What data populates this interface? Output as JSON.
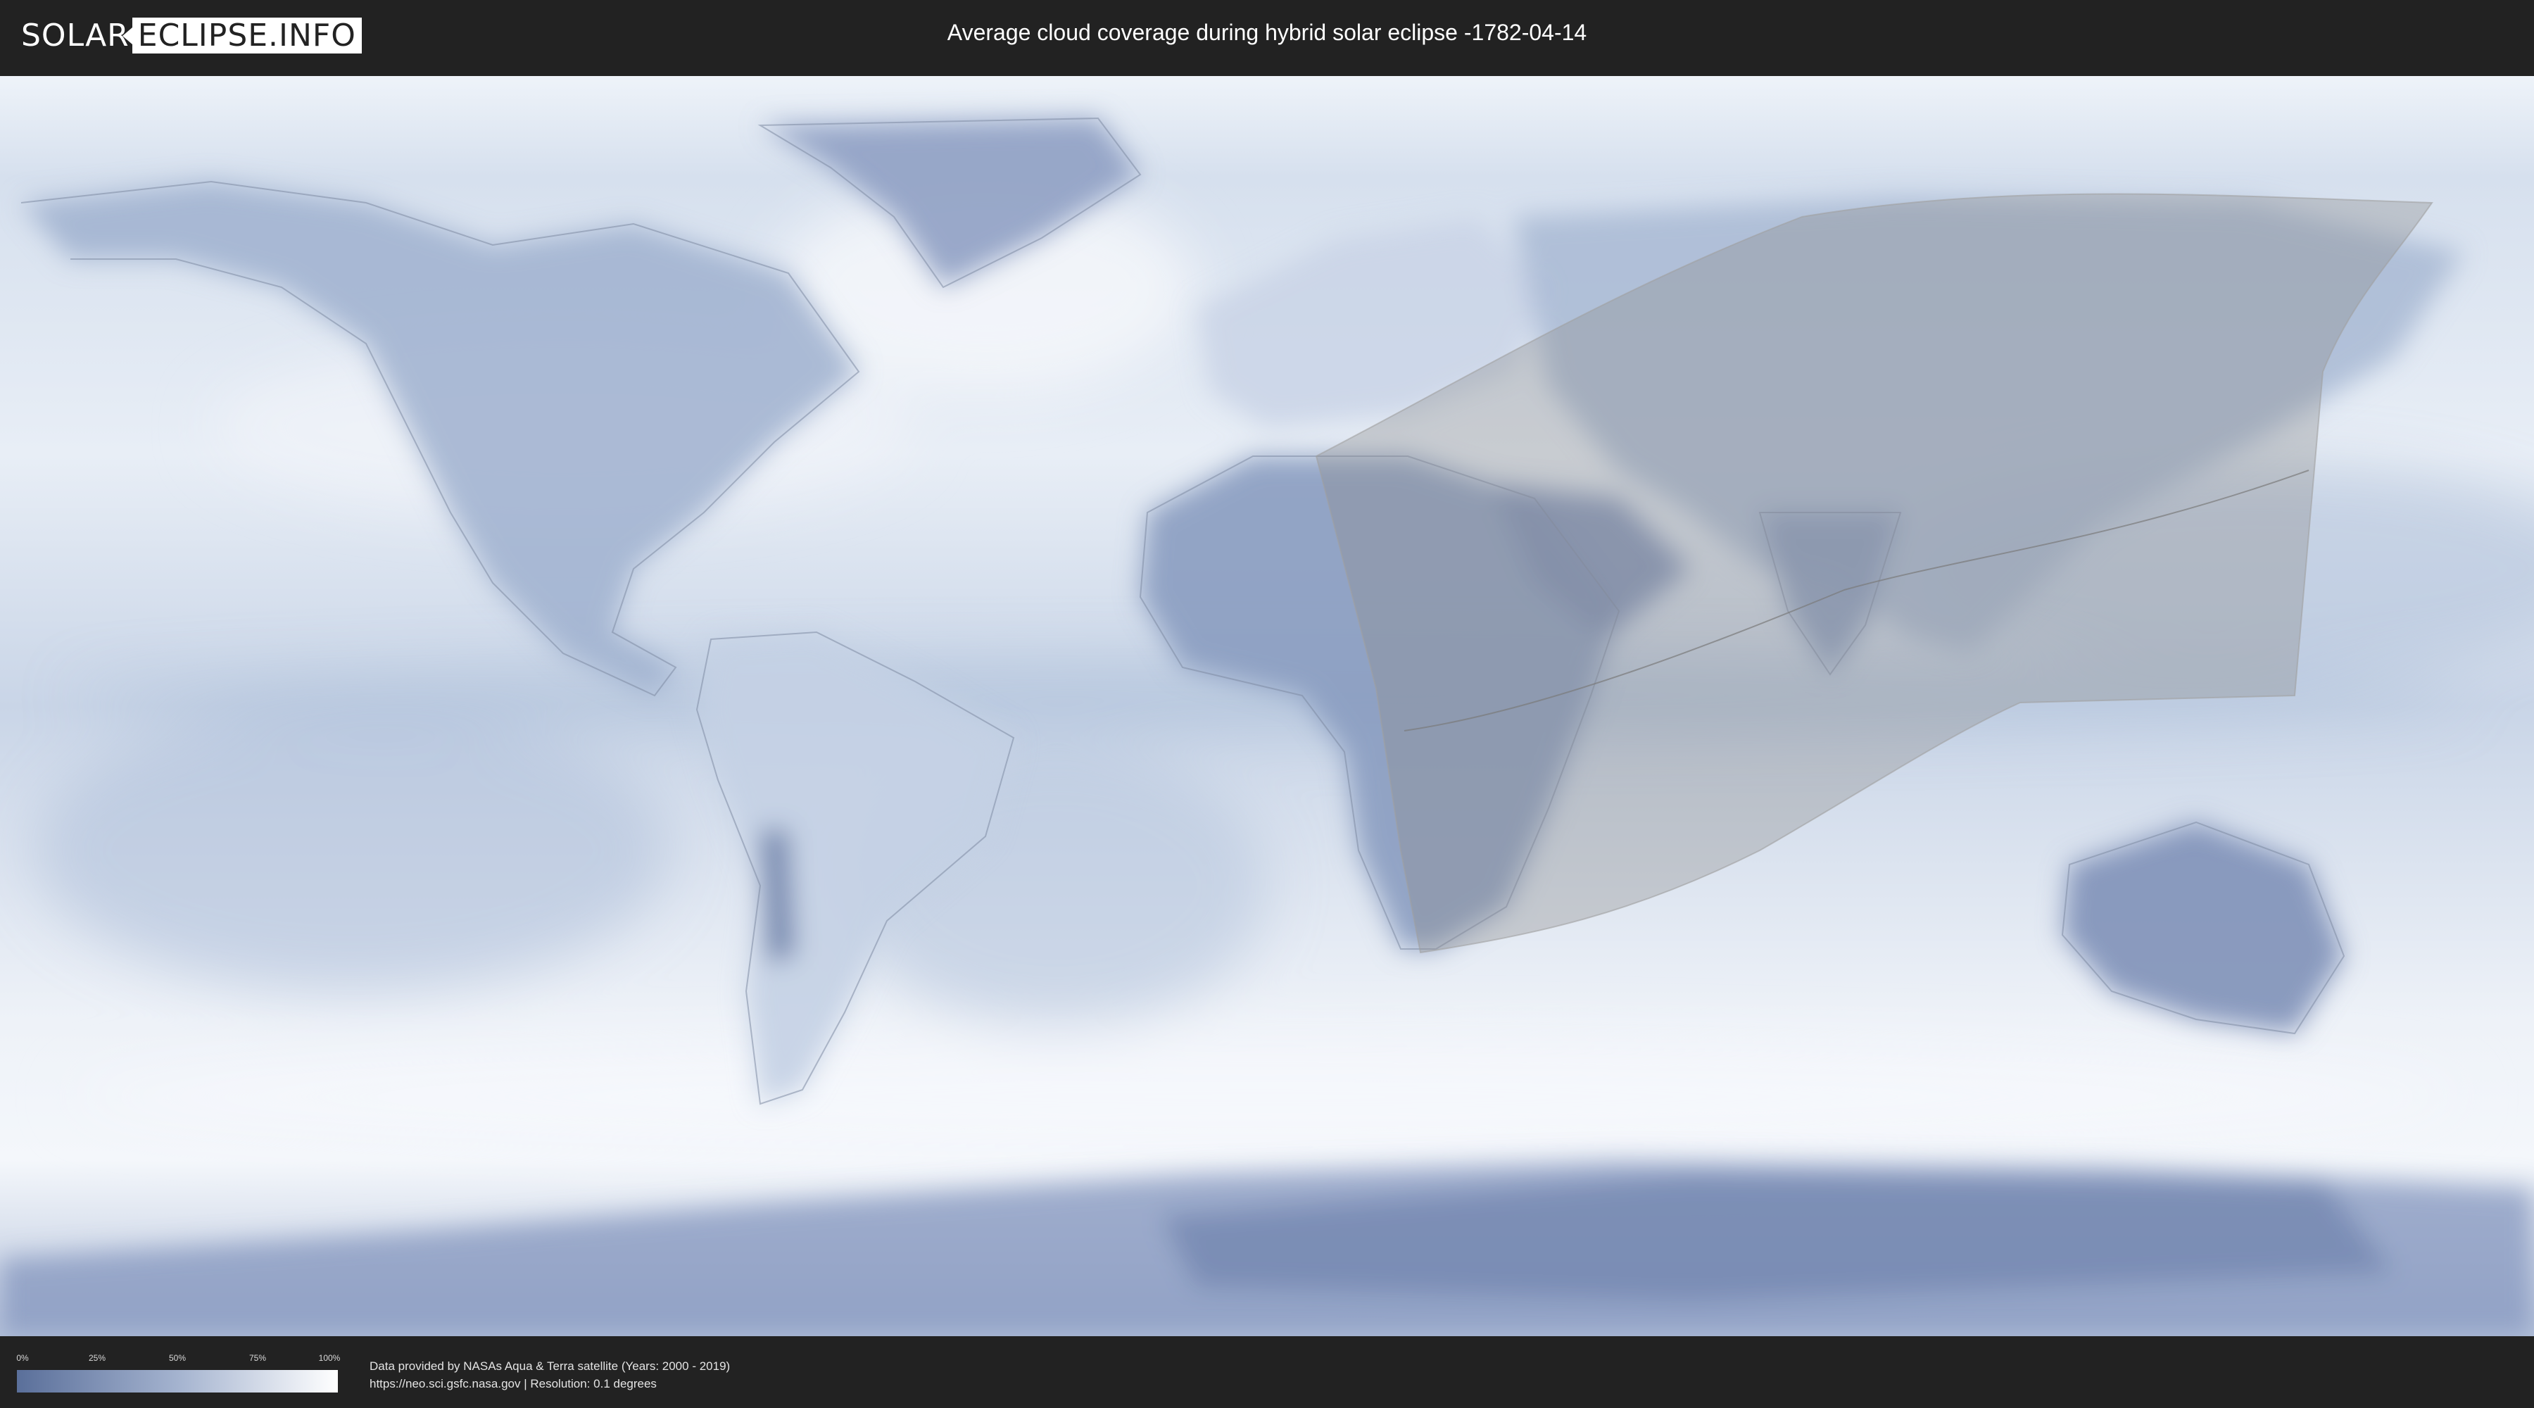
{
  "header": {
    "logo_left": "SOLAR",
    "logo_right": "ECLIPSE.INFO",
    "title": "Average cloud coverage during hybrid solar eclipse -1782-04-14"
  },
  "legend": {
    "ticks": [
      "0%",
      "25%",
      "50%",
      "75%",
      "100%"
    ],
    "scale_meaning": "cloud coverage",
    "colors": {
      "low": "#5a6f9a",
      "high": "#ffffff"
    }
  },
  "credits": {
    "line1": "Data provided by NASAs Aqua & Terra satellite (Years: 2000 - 2019)",
    "line2": "https://neo.sci.gsfc.nasa.gov | Resolution: 0.1 degrees"
  },
  "map": {
    "projection": "equirectangular",
    "layer": "cloud coverage",
    "eclipse_region": "partial visibility zone over Africa, Middle East and Asia",
    "colors": {
      "ocean_clear": "#c3d0e3",
      "cloudy": "#f2f5fa",
      "land_clear": "#8fa0c3",
      "eclipse_shade": "#8c8c8c"
    }
  }
}
